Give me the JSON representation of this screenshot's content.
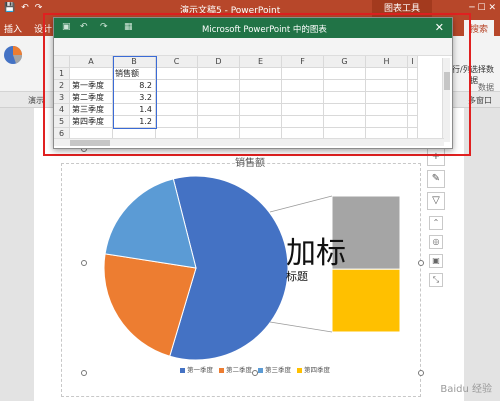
{
  "powerpoint": {
    "title": "演示文稿5 - PowerPoint",
    "context_tab": "图表工具",
    "search_label": "搜索",
    "tabs": [
      {
        "label": "插入"
      },
      {
        "label": "设计"
      }
    ],
    "ribbon_right_labels": [
      "行/列",
      "选择数据"
    ],
    "ribbon_group_label": "数据",
    "strip_left": "演示",
    "strip_right": "多窗口"
  },
  "excel": {
    "title": "Microsoft PowerPoint 中的图表",
    "columns": [
      "",
      "A",
      "B",
      "C",
      "D",
      "E",
      "F",
      "G",
      "H",
      "I"
    ],
    "rows": [
      {
        "num": "1",
        "a": "",
        "b": "销售额"
      },
      {
        "num": "2",
        "a": "第一季度",
        "b": "8.2"
      },
      {
        "num": "3",
        "a": "第二季度",
        "b": "3.2"
      },
      {
        "num": "4",
        "a": "第三季度",
        "b": "1.4"
      },
      {
        "num": "5",
        "a": "第四季度",
        "b": "1.2"
      },
      {
        "num": "6",
        "a": "",
        "b": ""
      }
    ]
  },
  "slide": {
    "big_text": "加标",
    "small_text": "标题"
  },
  "chart_data": {
    "type": "pie",
    "title": "销售额",
    "categories": [
      "第一季度",
      "第二季度",
      "第三季度",
      "第四季度"
    ],
    "series": [
      {
        "name": "销售额",
        "values": [
          8.2,
          3.2,
          1.4,
          1.2
        ]
      }
    ],
    "colors": [
      "#4472c4",
      "#ed7d31",
      "#5b9bd5",
      "#a5a5a5",
      "#ffc000"
    ],
    "style": "pie-of-pie"
  },
  "watermark": "Baidu 经验"
}
